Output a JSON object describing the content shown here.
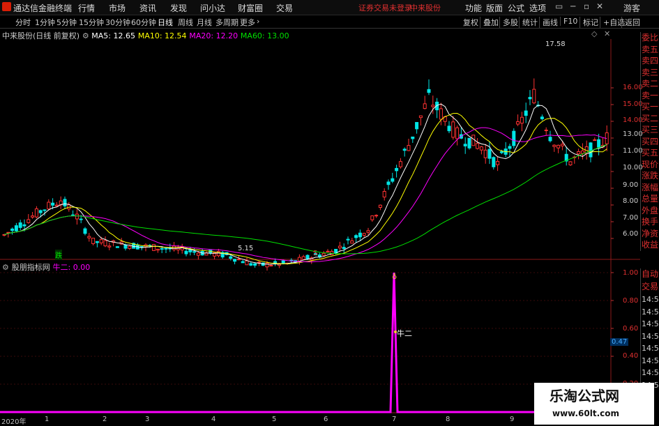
{
  "app": {
    "title": "通达信金融终端"
  },
  "menu": [
    "行情",
    "市场",
    "资讯",
    "发现",
    "问小达",
    "财富圈",
    "交易"
  ],
  "status_text": "证券交易未登录",
  "stock_top": "中来股份",
  "right_menu": [
    "功能",
    "版面",
    "公式",
    "选项"
  ],
  "guest": "游客",
  "periods": [
    "分时",
    "1分钟",
    "5分钟",
    "15分钟",
    "30分钟",
    "60分钟",
    "日线",
    "周线",
    "月线",
    "多周期",
    "更多"
  ],
  "active_period": "日线",
  "tools": [
    "复权",
    "叠加",
    "多股",
    "统计",
    "画线",
    "F10",
    "标记",
    "+自选",
    "返回"
  ],
  "main_info": {
    "stock": "中来股份(日线 前复权)",
    "ma5": "MA5: 12.65",
    "ma10": "MA10: 12.54",
    "ma20": "MA20: 12.20",
    "ma60": "MA60: 13.00"
  },
  "annotations": {
    "high": "17.58",
    "low": "5.15",
    "marker_die": "跌",
    "marker_s": "S"
  },
  "indicator": {
    "name": "股朋指标网",
    "line_label": "牛二: 0.00",
    "signal_label": "牛二",
    "current": "0.47"
  },
  "price_axis": [
    "16.00",
    "15.00",
    "14.00",
    "13.00",
    "12.00",
    "11.00",
    "10.00",
    "9.00",
    "8.00",
    "7.00",
    "6.00"
  ],
  "ind_axis": [
    "1.00",
    "0.80",
    "0.60",
    "0.40",
    "0.20"
  ],
  "x_axis": [
    "2020年",
    "1",
    "2",
    "3",
    "4",
    "5",
    "6",
    "7",
    "8",
    "9"
  ],
  "sidebar": [
    "委比",
    "卖五",
    "卖四",
    "卖三",
    "卖二",
    "卖一",
    "买一",
    "买二",
    "买三",
    "买四",
    "买五",
    "现价",
    "涨跌",
    "涨幅",
    "总量",
    "外盘",
    "换手",
    "净资",
    "收益"
  ],
  "sidebar2": [
    "自动",
    "交易",
    "14:56",
    "14:56",
    "14:56",
    "14:56",
    "14:56",
    "14:56",
    "14:56",
    "14:56"
  ],
  "watermark": {
    "title": "乐淘公式网",
    "url": "www.60lt.com"
  },
  "colors": {
    "up": "#ff3232",
    "down": "#00e5e5",
    "ma5": "#ffffff",
    "ma10": "#ffff00",
    "ma20": "#ff00ff",
    "ma60": "#00e000",
    "accent": "#e03030"
  },
  "chart_data": {
    "type": "candlestick",
    "price_range": [
      5.15,
      17.58
    ],
    "indicator_range": [
      0,
      1.0
    ],
    "indicator_peak": 1.0
  }
}
